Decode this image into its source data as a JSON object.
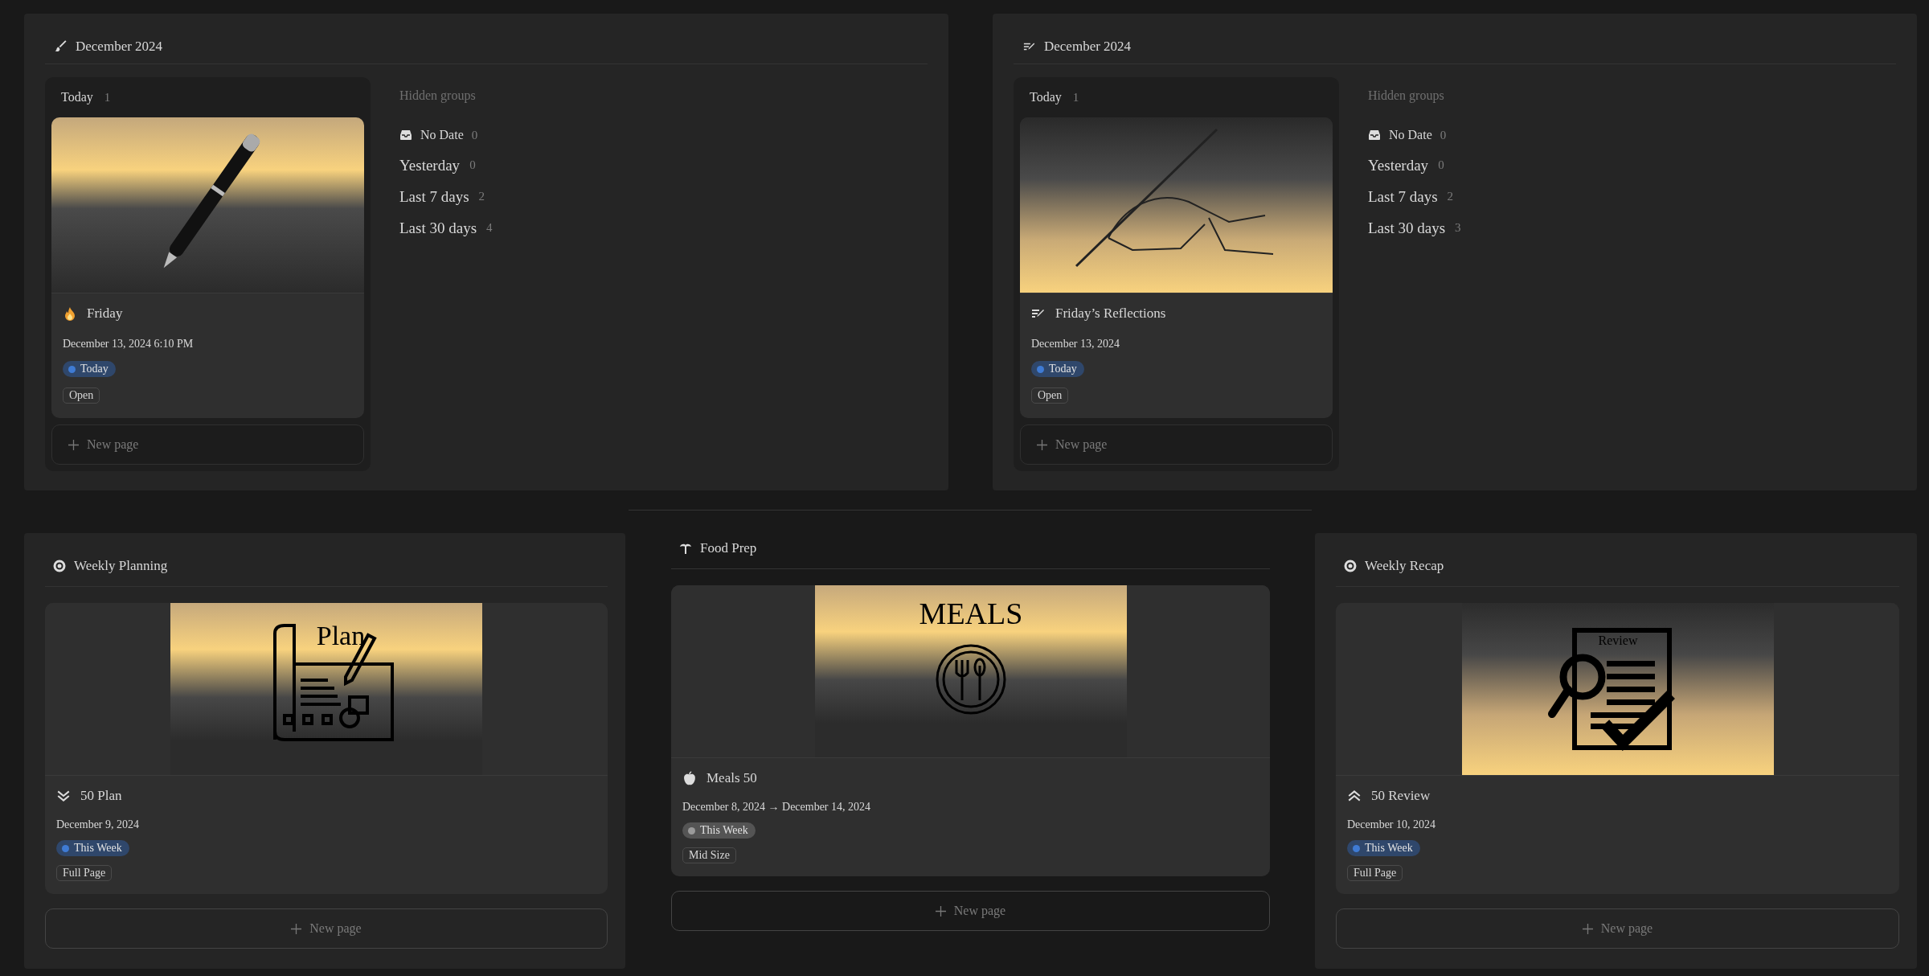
{
  "boards": [
    {
      "title": "December 2024",
      "column": {
        "label": "Today",
        "count": "1",
        "cards": [
          {
            "title": "Friday",
            "date": "December 13, 2024 6:10 PM",
            "status": {
              "label": "Today",
              "color": "#3f7bd4"
            },
            "tag": "Open"
          }
        ],
        "new_page": "New page"
      },
      "hidden": {
        "label": "Hidden groups",
        "groups": [
          {
            "kind": "no_date",
            "label": "No Date",
            "count": "0"
          },
          {
            "kind": "range",
            "label": "Yesterday",
            "count": "0"
          },
          {
            "kind": "range",
            "label": "Last 7 days",
            "count": "2"
          },
          {
            "kind": "range",
            "label": "Last 30 days",
            "count": "4"
          }
        ]
      }
    },
    {
      "title": "December 2024",
      "column": {
        "label": "Today",
        "count": "1",
        "cards": [
          {
            "title": "Friday’s Reflections",
            "date": "December 13, 2024",
            "status": {
              "label": "Today",
              "color": "#3f7bd4"
            },
            "tag": "Open"
          }
        ],
        "new_page": "New page"
      },
      "hidden": {
        "label": "Hidden groups",
        "groups": [
          {
            "kind": "no_date",
            "label": "No Date",
            "count": "0"
          },
          {
            "kind": "range",
            "label": "Yesterday",
            "count": "0"
          },
          {
            "kind": "range",
            "label": "Last 7 days",
            "count": "2"
          },
          {
            "kind": "range",
            "label": "Last 30 days",
            "count": "3"
          }
        ]
      }
    }
  ],
  "galleries": [
    {
      "title": "Weekly Planning",
      "framed": true,
      "card": {
        "cover_text": "Plan",
        "title": "50 Plan",
        "date": "December 9, 2024",
        "status": {
          "label": "This Week",
          "color": "#3f7bd4"
        },
        "tag": "Full Page"
      },
      "new_page": "New page"
    },
    {
      "title": "Food Prep",
      "framed": false,
      "card": {
        "cover_text": "MEALS",
        "title": "Meals 50",
        "date": "December 8, 2024 → December 14, 2024",
        "status": {
          "label": "This Week",
          "color": "#9a9a9a"
        },
        "tag": "Mid Size"
      },
      "new_page": "New page"
    },
    {
      "title": "Weekly Recap",
      "framed": true,
      "card": {
        "cover_text": "Review",
        "title": "50 Review",
        "date": "December 10, 2024",
        "status": {
          "label": "This Week",
          "color": "#3f7bd4"
        },
        "tag": "Full Page"
      },
      "new_page": "New page"
    }
  ]
}
